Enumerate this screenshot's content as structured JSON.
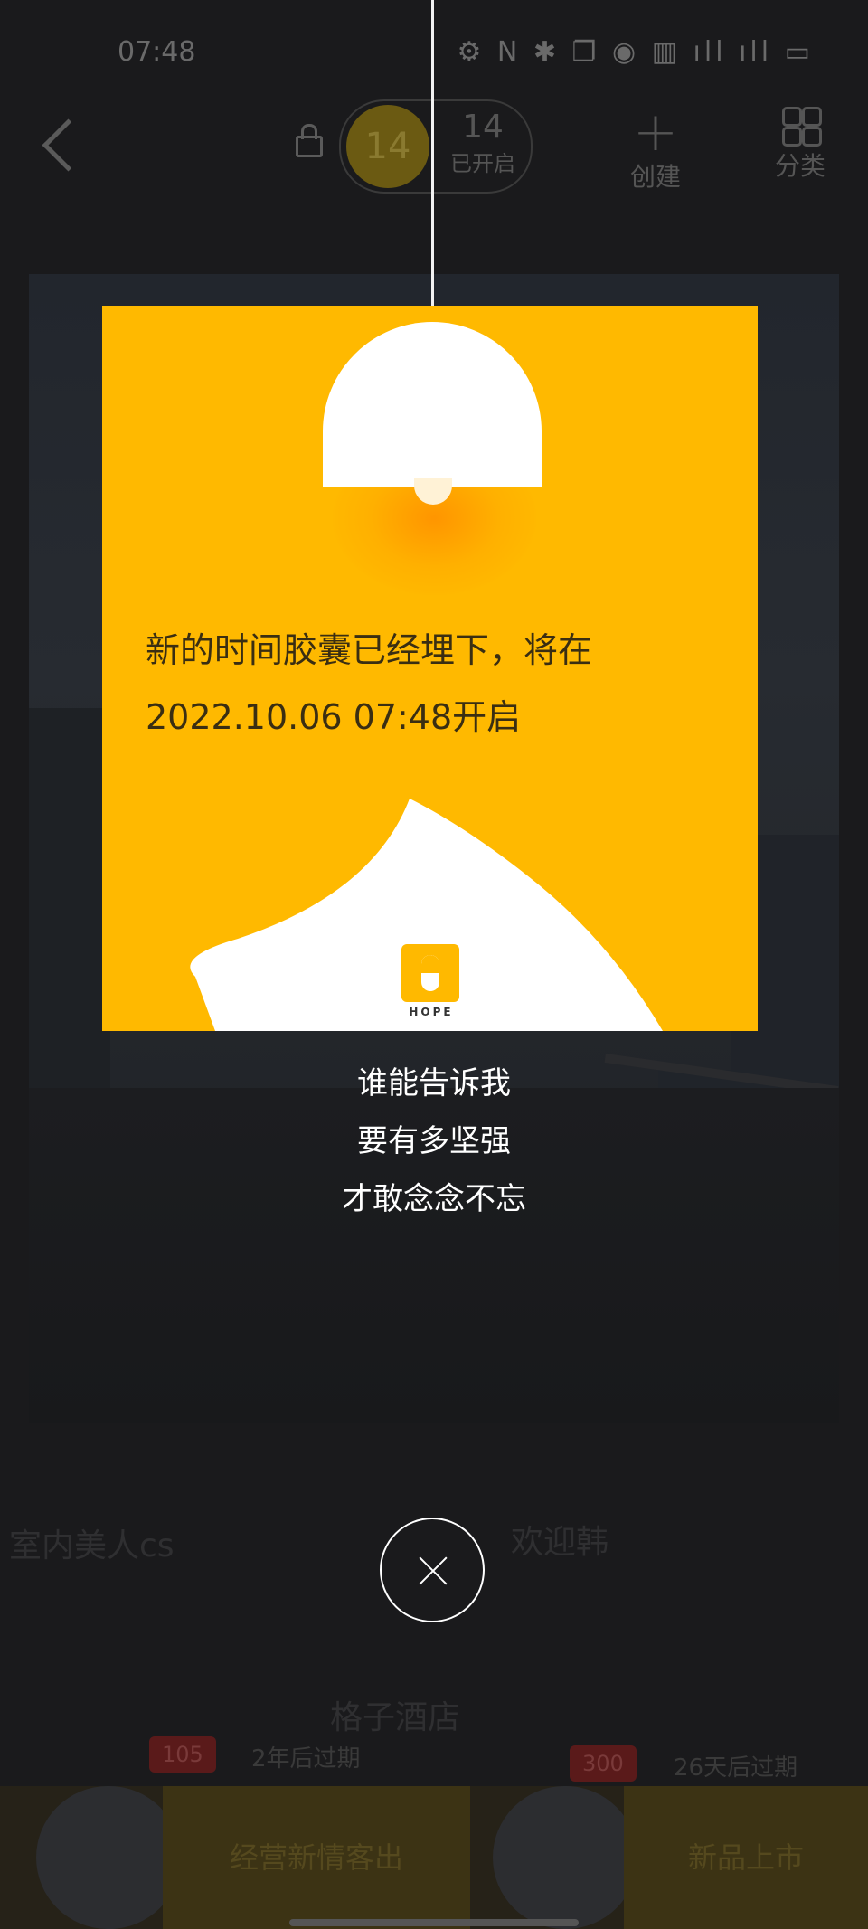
{
  "status_bar": {
    "time": "07:48",
    "icons": "⚙ N ✱ ❐ ◉ ▥ ıll ıll ▭"
  },
  "nav": {
    "yellow_count": "14",
    "pill_count": "14",
    "pill_label": "已开启",
    "create_label": "创建",
    "category_label": "分类"
  },
  "card": {
    "line1": "新的时间胶囊已经埋下，将在",
    "line2": "2022.10.06 07:48开启",
    "brand": "HOPE"
  },
  "lyrics": [
    "谁能告诉我",
    "要有多坚强",
    "才敢念念不忘"
  ],
  "background_list": {
    "user_left": "室内美人cs",
    "user_right": "欢迎韩",
    "hotel_name": "格子酒店",
    "left_badge": "105",
    "left_expiry": "2年后过期",
    "right_badge": "300",
    "right_expiry": "26天后过期",
    "bottom_left_label": "经营新情客出",
    "bottom_right_label": "新品上市"
  },
  "colors": {
    "accent": "#ffb900",
    "overlay_text": "#ffffff"
  }
}
